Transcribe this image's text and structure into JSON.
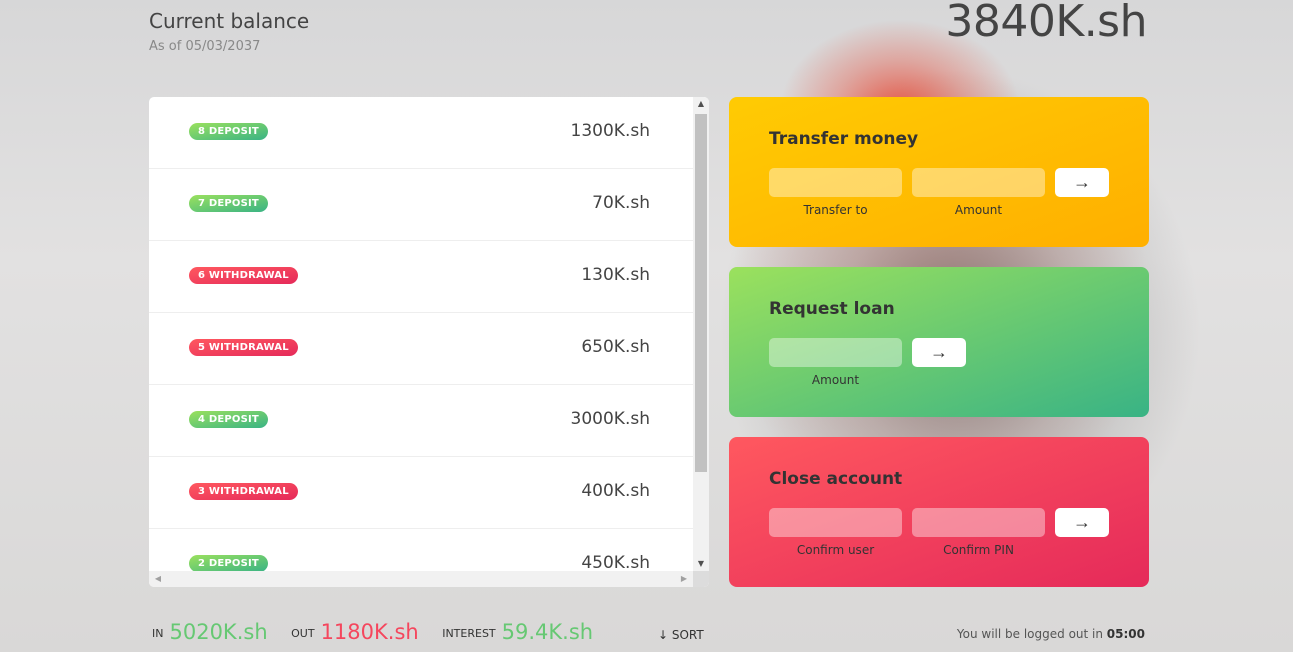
{
  "header": {
    "title": "Current balance",
    "date": "As of 05/03/2037",
    "balance": "3840K.sh"
  },
  "movements": [
    {
      "type": "8 deposit",
      "kind": "deposit",
      "value": "1300K.sh"
    },
    {
      "type": "7 deposit",
      "kind": "deposit",
      "value": "70K.sh"
    },
    {
      "type": "6 withdrawal",
      "kind": "withdrawal",
      "value": "130K.sh"
    },
    {
      "type": "5 withdrawal",
      "kind": "withdrawal",
      "value": "650K.sh"
    },
    {
      "type": "4 deposit",
      "kind": "deposit",
      "value": "3000K.sh"
    },
    {
      "type": "3 withdrawal",
      "kind": "withdrawal",
      "value": "400K.sh"
    },
    {
      "type": "2 deposit",
      "kind": "deposit",
      "value": "450K.sh"
    }
  ],
  "transfer": {
    "title": "Transfer money",
    "to_label": "Transfer to",
    "amount_label": "Amount",
    "button": "→"
  },
  "loan": {
    "title": "Request loan",
    "amount_label": "Amount",
    "button": "→"
  },
  "close": {
    "title": "Close account",
    "user_label": "Confirm user",
    "pin_label": "Confirm PIN",
    "button": "→"
  },
  "summary": {
    "in_label": "In",
    "in_value": "5020K.sh",
    "out_label": "Out",
    "out_value": "1180K.sh",
    "interest_label": "Interest",
    "interest_value": "59.4K.sh",
    "sort_label": "↓ SORT"
  },
  "logout": {
    "text": "You will be logged out in ",
    "timer": "05:00"
  },
  "colors": {
    "deposit": "#66c873",
    "withdrawal": "#f5465d",
    "transfer": "#ffb003",
    "loan": "#5ec576",
    "close": "#ff585f"
  }
}
